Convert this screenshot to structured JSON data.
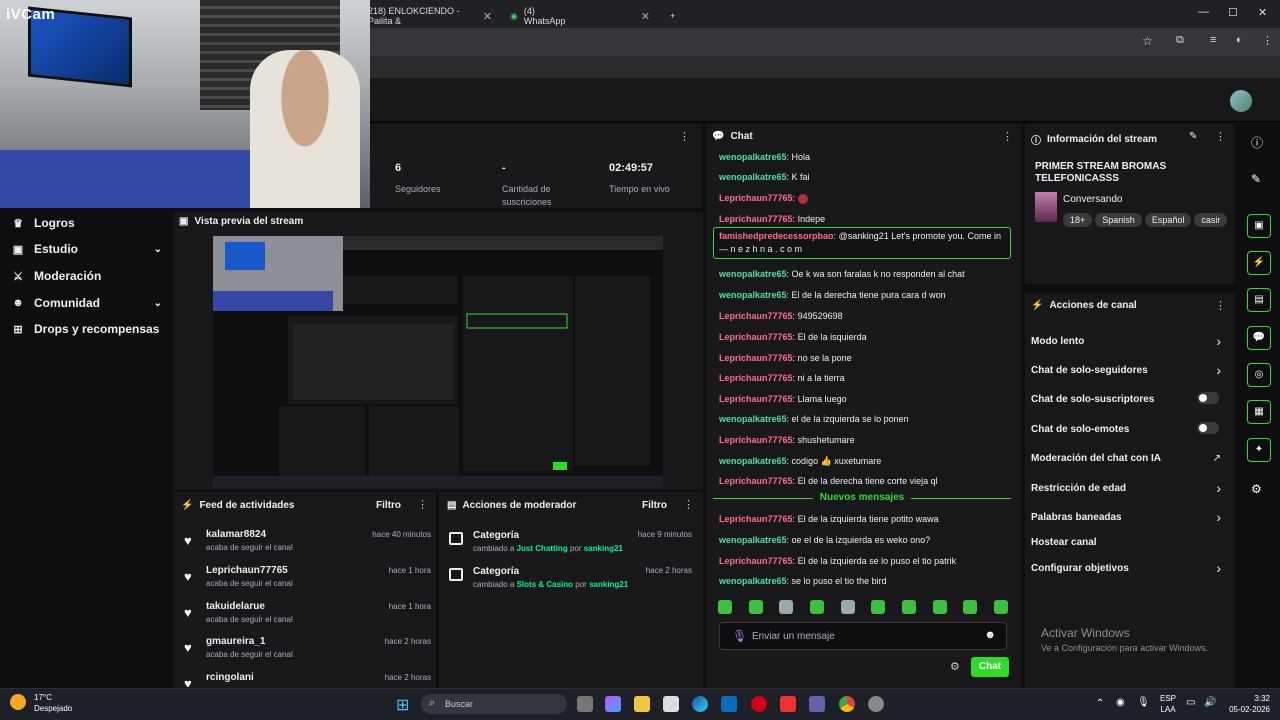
{
  "browser": {
    "tabs": [
      {
        "label": "218) ENLOKCIENDO - Pailita &"
      },
      {
        "label": "(4) WhatsApp"
      }
    ]
  },
  "webcam": {
    "label": "iVCam"
  },
  "stats": [
    {
      "value": "6",
      "label": "Seguidores"
    },
    {
      "value": "-",
      "label": "Cantidad de suscriciones"
    },
    {
      "value": "02:49:57",
      "label": "Tiempo en vivo"
    }
  ],
  "nav": {
    "items": [
      {
        "label": "Logros",
        "icon": "trophy-icon"
      },
      {
        "label": "Estudio",
        "icon": "studio-icon"
      },
      {
        "label": "Moderación",
        "icon": "sword-icon"
      },
      {
        "label": "Comunidad",
        "icon": "community-icon"
      },
      {
        "label": "Drops y recompensas",
        "icon": "gift-icon"
      }
    ]
  },
  "preview": {
    "title": "Vista previa del stream"
  },
  "feed": {
    "title": "Feed de actividades",
    "filter": "Filtro",
    "items": [
      {
        "name": "kalamar8824",
        "sub": "acaba de seguir el canal",
        "time": "hace 40 minutos"
      },
      {
        "name": "Leprichaun77765",
        "sub": "acaba de seguir el canal",
        "time": "hace 1 hora"
      },
      {
        "name": "takuidelarue",
        "sub": "acaba de seguir el canal",
        "time": "hace 1 hora"
      },
      {
        "name": "gmaureira_1",
        "sub": "acaba de seguir el canal",
        "time": "hace 2 horas"
      },
      {
        "name": "rcingolani",
        "sub": "",
        "time": "hace 2 horas"
      }
    ]
  },
  "modactions": {
    "title": "Acciones de moderador",
    "filter": "Filtro",
    "items": [
      {
        "name": "Categoría",
        "pre": "cambiado a",
        "cat": "Just Chatting",
        "por": "por",
        "user": "sanking21",
        "time": "hace 9 minutos"
      },
      {
        "name": "Categoría",
        "pre": "cambiado a",
        "cat": "Slots & Casino",
        "por": "por",
        "user": "sanking21",
        "time": "hace 2 horas"
      }
    ]
  },
  "chat": {
    "title": "Chat",
    "lines": [
      {
        "user": "wenopalkatre65",
        "msg": "Hola",
        "c": "u1"
      },
      {
        "user": "wenopalkatre65",
        "msg": "K fai",
        "c": "u1"
      },
      {
        "user": "Leprichaun77765",
        "msg": "",
        "c": "u2"
      },
      {
        "user": "Leprichaun77765",
        "msg": "Indepe",
        "c": "u2"
      },
      {
        "user": "wenopalkatre65",
        "msg": "Oe k wa son faralas k no responden al chat",
        "c": "u1"
      },
      {
        "user": "wenopalkatre65",
        "msg": "El de la derecha tiene pura cara d won",
        "c": "u1"
      },
      {
        "user": "Leprichaun77765",
        "msg": "949529698",
        "c": "u2"
      },
      {
        "user": "Leprichaun77765",
        "msg": "El de la isquierda",
        "c": "u2"
      },
      {
        "user": "Leprichaun77765",
        "msg": "no se la pone",
        "c": "u2"
      },
      {
        "user": "Leprichaun77765",
        "msg": "ni a la tierra",
        "c": "u2"
      },
      {
        "user": "Leprichaun77765",
        "msg": "Llama luego",
        "c": "u2"
      },
      {
        "user": "wenopalkatre65",
        "msg": "el de la izquierda se lo ponen",
        "c": "u1"
      },
      {
        "user": "Leprichaun77765",
        "msg": "shushetumare",
        "c": "u2"
      },
      {
        "user": "wenopalkatre65",
        "msg": "codigo 👍 xuxetumare",
        "c": "u1"
      },
      {
        "user": "Leprichaun77765",
        "msg": "El de la derecha tiene corte vieja ql",
        "c": "u2"
      }
    ],
    "promo": {
      "user": "famishedpredecessorpbao",
      "msg": "@sanking21 Let's promote you. Come in — n e z h n a . c o m"
    },
    "new_messages": "Nuevos mensajes",
    "lines_after": [
      {
        "user": "Leprichaun77765",
        "msg": "El de la izquierda tiene potito wawa",
        "c": "u2"
      },
      {
        "user": "wenopalkatre65",
        "msg": "oe el de la izquierda es weko ono?",
        "c": "u1"
      },
      {
        "user": "Leprichaun77765",
        "msg": "El de la izquierda se lo puso el tio patrik",
        "c": "u2"
      },
      {
        "user": "wenopalkatre65",
        "msg": "se lo puso el tio the bird",
        "c": "u1"
      }
    ],
    "input_placeholder": "Enviar un mensaje",
    "send_label": "Chat"
  },
  "info": {
    "title": "Información del stream",
    "stream_title": "PRIMER STREAM BROMAS TELEFONICASSS",
    "category": "Conversando",
    "tags": [
      "18+",
      "Spanish",
      "Español",
      "casir"
    ]
  },
  "channel_actions": {
    "title": "Acciones de canal",
    "items": [
      {
        "label": "Modo lento",
        "kind": "chevron"
      },
      {
        "label": "Chat de solo-seguidores",
        "kind": "chevron"
      },
      {
        "label": "Chat de solo-suscriptores",
        "kind": "toggle"
      },
      {
        "label": "Chat de solo-emotes",
        "kind": "toggle"
      },
      {
        "label": "Moderación del chat con IA",
        "kind": "external"
      },
      {
        "label": "Restricción de edad",
        "kind": "chevron"
      },
      {
        "label": "Palabras baneadas",
        "kind": "chevron"
      },
      {
        "label": "Hostear canal",
        "kind": "none"
      },
      {
        "label": "Configurar objetivos",
        "kind": "chevron"
      }
    ]
  },
  "watermark": {
    "line1": "Activar Windows",
    "line2": "Ve a Configuración para activar Windows."
  },
  "taskbar": {
    "weather_temp": "17°C",
    "weather_desc": "Despejado",
    "search_placeholder": "Buscar",
    "lang_top": "ESP",
    "lang_bottom": "LAA",
    "time": "3:32",
    "date": "05-02-2026"
  },
  "colors": {
    "accent": "#2fdc28",
    "bg": "#0e0e10",
    "panel": "#18181b"
  }
}
